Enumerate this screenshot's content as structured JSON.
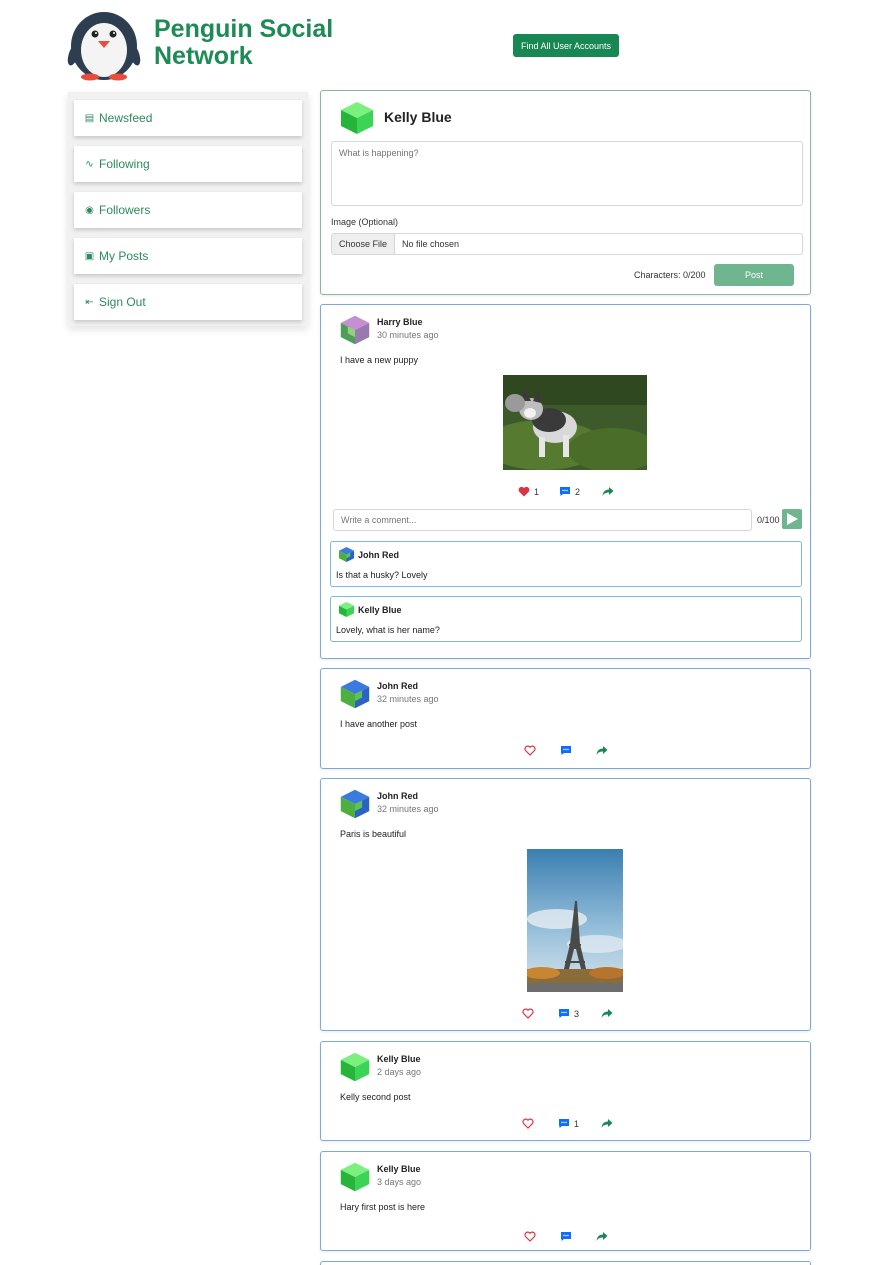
{
  "brand": {
    "name_line1": "Penguin Social",
    "name_line2": "Network"
  },
  "header": {
    "find_button": "Find All User Accounts"
  },
  "sidebar": {
    "items": [
      {
        "label": "Newsfeed",
        "icon": "newspaper-icon"
      },
      {
        "label": "Following",
        "icon": "following-icon"
      },
      {
        "label": "Followers",
        "icon": "followers-icon"
      },
      {
        "label": "My Posts",
        "icon": "my-posts-icon"
      },
      {
        "label": "Sign Out",
        "icon": "sign-out-icon"
      }
    ]
  },
  "composer": {
    "user": "Kelly Blue",
    "placeholder": "What is happening?",
    "image_label": "Image (Optional)",
    "choose_file": "Choose File",
    "no_file": "No file chosen",
    "char_count": "Characters: 0/200",
    "post_button": "Post"
  },
  "posts": [
    {
      "author": "Harry Blue",
      "time": "30 minutes ago",
      "text": "I have a new puppy",
      "likes": "1",
      "comments": "2",
      "comment_placeholder": "Write a comment...",
      "comment_count": "0/100",
      "comments_list": [
        {
          "author": "John Red",
          "text": "Is that a husky? Lovely"
        },
        {
          "author": "Kelly Blue",
          "text": "Lovely, what is her name?"
        }
      ]
    },
    {
      "author": "John Red",
      "time": "32 minutes ago",
      "text": "I have another post"
    },
    {
      "author": "John Red",
      "time": "32 minutes ago",
      "text": "Paris is beautiful",
      "comments": "3"
    },
    {
      "author": "Kelly Blue",
      "time": "2 days ago",
      "text": "Kelly second post",
      "comments": "1"
    },
    {
      "author": "Kelly Blue",
      "time": "3 days ago",
      "text": "Hary first post is here"
    }
  ],
  "colors": {
    "brand": "#1e8a55",
    "card_border": "#7aaad9",
    "like": "#dc3545",
    "comment": "#0d6efd",
    "share": "#198754"
  }
}
